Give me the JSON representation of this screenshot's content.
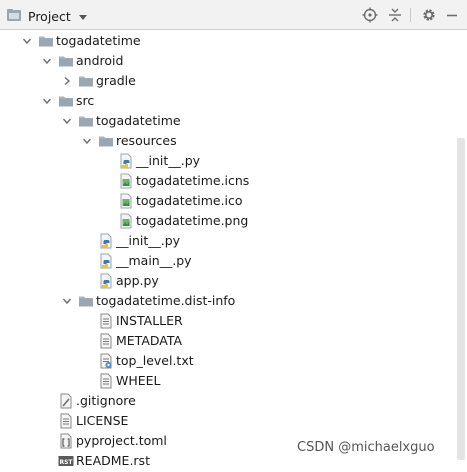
{
  "panel": {
    "title": "Project"
  },
  "toolbar": {
    "locate_icon": "target-icon",
    "collapse_icon": "collapse-all-icon",
    "settings_icon": "gear-icon",
    "hide_icon": "minimize-icon"
  },
  "tree": [
    {
      "label": "togadatetime",
      "depth": 0,
      "expanded": true,
      "icon": "folder-icon"
    },
    {
      "label": "android",
      "depth": 1,
      "expanded": true,
      "icon": "folder-icon"
    },
    {
      "label": "gradle",
      "depth": 2,
      "expanded": false,
      "icon": "folder-icon"
    },
    {
      "label": "src",
      "depth": 1,
      "expanded": true,
      "icon": "folder-icon"
    },
    {
      "label": "togadatetime",
      "depth": 2,
      "expanded": true,
      "icon": "folder-icon"
    },
    {
      "label": "resources",
      "depth": 3,
      "expanded": true,
      "icon": "folder-icon"
    },
    {
      "label": "__init__.py",
      "depth": 4,
      "icon": "python-file-icon"
    },
    {
      "label": "togadatetime.icns",
      "depth": 4,
      "icon": "image-file-icon"
    },
    {
      "label": "togadatetime.ico",
      "depth": 4,
      "icon": "image-file-icon"
    },
    {
      "label": "togadatetime.png",
      "depth": 4,
      "icon": "image-file-icon"
    },
    {
      "label": "__init__.py",
      "depth": 3,
      "icon": "python-file-icon"
    },
    {
      "label": "__main__.py",
      "depth": 3,
      "icon": "python-file-icon"
    },
    {
      "label": "app.py",
      "depth": 3,
      "icon": "python-file-icon"
    },
    {
      "label": "togadatetime.dist-info",
      "depth": 2,
      "expanded": true,
      "icon": "folder-icon"
    },
    {
      "label": "INSTALLER",
      "depth": 3,
      "icon": "text-file-icon"
    },
    {
      "label": "METADATA",
      "depth": 3,
      "icon": "text-file-icon"
    },
    {
      "label": "top_level.txt",
      "depth": 3,
      "icon": "txt-file-icon"
    },
    {
      "label": "WHEEL",
      "depth": 3,
      "icon": "text-file-icon"
    },
    {
      "label": ".gitignore",
      "depth": 1,
      "icon": "gitignore-file-icon"
    },
    {
      "label": "LICENSE",
      "depth": 1,
      "icon": "text-file-icon"
    },
    {
      "label": "pyproject.toml",
      "depth": 1,
      "icon": "toml-file-icon"
    },
    {
      "label": "README.rst",
      "depth": 1,
      "icon": "rst-file-icon"
    }
  ],
  "watermark": "CSDN @michaelxguo"
}
